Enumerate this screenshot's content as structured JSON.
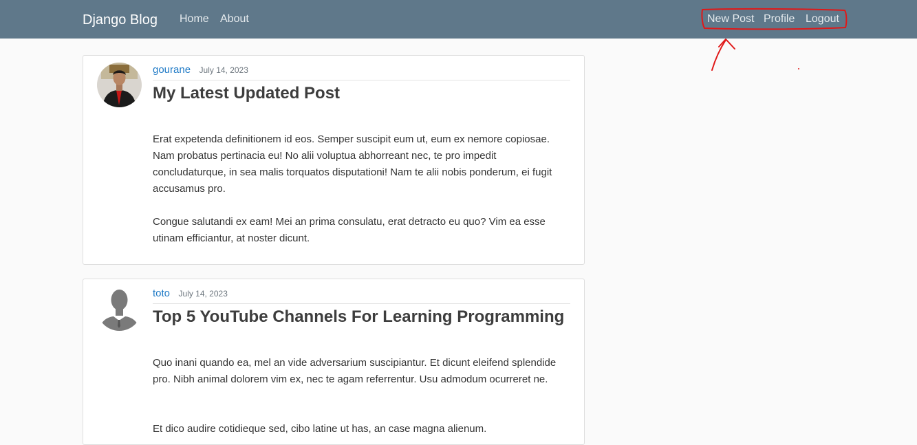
{
  "navbar": {
    "brand": "Django Blog",
    "left_links": [
      "Home",
      "About"
    ],
    "right_links": [
      "New Post",
      "Profile",
      "Logout"
    ],
    "background_color": "#5f788a"
  },
  "annotation": {
    "color": "#e01818"
  },
  "posts": [
    {
      "author": "gourane",
      "date": "July 14, 2023",
      "title": "My Latest Updated Post",
      "paragraphs": [
        "Erat expetenda definitionem id eos. Semper suscipit eum ut, eum ex nemore copiosae. Nam probatus pertinacia eu! No alii voluptua abhorreant nec, te pro impedit concludaturque, in sea malis torquatos disputationi! Nam te alii nobis ponderum, ei fugit accusamus pro.",
        "Congue salutandi ex eam! Mei an prima consulatu, erat detracto eu quo? Vim ea esse utinam efficiantur, at noster dicunt."
      ]
    },
    {
      "author": "toto",
      "date": "July 14, 2023",
      "title": "Top 5 YouTube Channels For Learning Programming",
      "paragraphs": [
        "Quo inani quando ea, mel an vide adversarium suscipiantur. Et dicunt eleifend splendide pro. Nibh animal dolorem vim ex, nec te agam referrentur. Usu admodum ocurreret ne.",
        "Et dico audire cotidieque sed, cibo latine ut has, an case magna alienum."
      ]
    }
  ]
}
